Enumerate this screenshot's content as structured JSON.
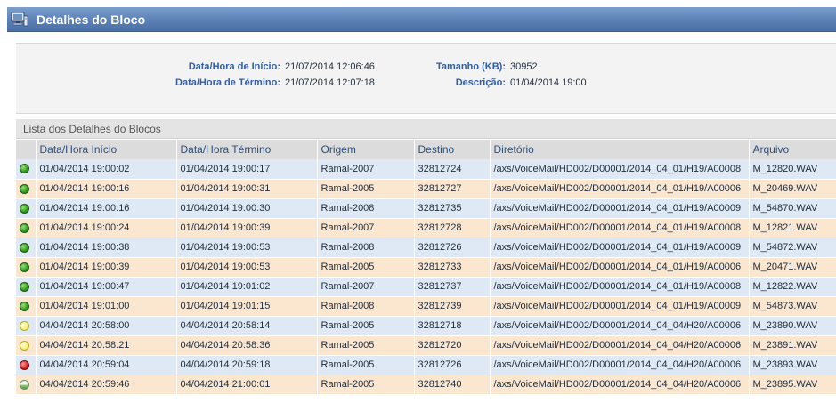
{
  "header": {
    "title": "Detalhes do Bloco",
    "logo_icon": "computer-icon"
  },
  "info": {
    "start_label": "Data/Hora de Início:",
    "start_value": "21/07/2014 12:06:46",
    "end_label": "Data/Hora de Término:",
    "end_value": "21/07/2014 12:07:18",
    "size_label": "Tamanho (KB):",
    "size_value": "30952",
    "desc_label": "Descrição:",
    "desc_value": "01/04/2014 19:00"
  },
  "list": {
    "title": "Lista dos Detalhes do Blocos",
    "columns": [
      "Data/Hora Início",
      "Data/Hora Término",
      "Origem",
      "Destino",
      "Diretório",
      "Arquivo"
    ],
    "status_colors": {
      "green": "#2e9a1e",
      "yellow": "#f6f07a",
      "red": "#d02020",
      "half": "#9ccf86"
    },
    "rows": [
      {
        "status": "green",
        "cells": [
          "01/04/2014 19:00:02",
          "01/04/2014 19:00:17",
          "Ramal-2007",
          "32812724",
          "/axs/VoiceMail/HD002/D00001/2014_04_01/H19/A00008",
          "M_12820.WAV"
        ]
      },
      {
        "status": "green",
        "cells": [
          "01/04/2014 19:00:16",
          "01/04/2014 19:00:31",
          "Ramal-2005",
          "32812727",
          "/axs/VoiceMail/HD002/D00001/2014_04_01/H19/A00006",
          "M_20469.WAV"
        ]
      },
      {
        "status": "green",
        "cells": [
          "01/04/2014 19:00:16",
          "01/04/2014 19:00:30",
          "Ramal-2008",
          "32812735",
          "/axs/VoiceMail/HD002/D00001/2014_04_01/H19/A00009",
          "M_54870.WAV"
        ]
      },
      {
        "status": "green",
        "cells": [
          "01/04/2014 19:00:24",
          "01/04/2014 19:00:39",
          "Ramal-2007",
          "32812728",
          "/axs/VoiceMail/HD002/D00001/2014_04_01/H19/A00008",
          "M_12821.WAV"
        ]
      },
      {
        "status": "green",
        "cells": [
          "01/04/2014 19:00:38",
          "01/04/2014 19:00:53",
          "Ramal-2008",
          "32812726",
          "/axs/VoiceMail/HD002/D00001/2014_04_01/H19/A00009",
          "M_54872.WAV"
        ]
      },
      {
        "status": "green",
        "cells": [
          "01/04/2014 19:00:39",
          "01/04/2014 19:00:53",
          "Ramal-2005",
          "32812733",
          "/axs/VoiceMail/HD002/D00001/2014_04_01/H19/A00006",
          "M_20471.WAV"
        ]
      },
      {
        "status": "green",
        "cells": [
          "01/04/2014 19:00:47",
          "01/04/2014 19:01:02",
          "Ramal-2007",
          "32812737",
          "/axs/VoiceMail/HD002/D00001/2014_04_01/H19/A00008",
          "M_12822.WAV"
        ]
      },
      {
        "status": "green",
        "cells": [
          "01/04/2014 19:01:00",
          "01/04/2014 19:01:15",
          "Ramal-2008",
          "32812739",
          "/axs/VoiceMail/HD002/D00001/2014_04_01/H19/A00009",
          "M_54873.WAV"
        ]
      },
      {
        "status": "yellow",
        "cells": [
          "04/04/2014 20:58:00",
          "04/04/2014 20:58:14",
          "Ramal-2005",
          "32812718",
          "/axs/VoiceMail/HD002/D00001/2014_04_04/H20/A00006",
          "M_23890.WAV"
        ]
      },
      {
        "status": "yellow",
        "cells": [
          "04/04/2014 20:58:21",
          "04/04/2014 20:58:36",
          "Ramal-2005",
          "32812720",
          "/axs/VoiceMail/HD002/D00001/2014_04_04/H20/A00006",
          "M_23891.WAV"
        ]
      },
      {
        "status": "red",
        "cells": [
          "04/04/2014 20:59:04",
          "04/04/2014 20:59:18",
          "Ramal-2005",
          "32812726",
          "/axs/VoiceMail/HD002/D00001/2014_04_04/H20/A00006",
          "M_23893.WAV"
        ]
      },
      {
        "status": "half",
        "cells": [
          "04/04/2014 20:59:46",
          "04/04/2014 21:00:01",
          "Ramal-2005",
          "32812740",
          "/axs/VoiceMail/HD002/D00001/2014_04_04/H20/A00006",
          "M_23895.WAV"
        ]
      }
    ]
  }
}
